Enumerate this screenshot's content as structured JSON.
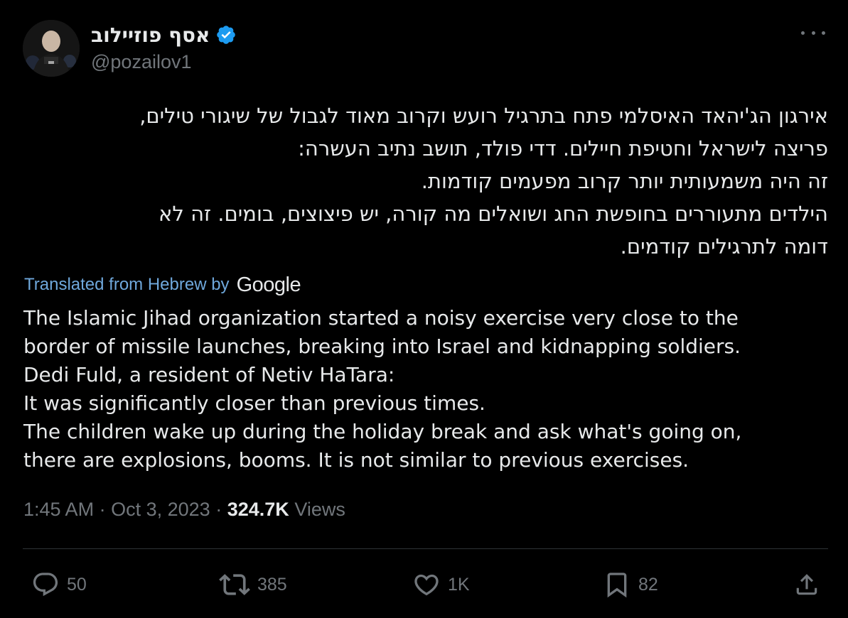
{
  "author": {
    "name": "אסף פוזיילוב",
    "handle": "@pozailov1",
    "verified": true,
    "verified_color": "#1d9bf0"
  },
  "hebrew_text": [
    "אירגון הג'יהאד האיסלמי פתח  בתרגיל רועש וקרוב מאוד לגבול של  שיגורי טילים,",
    "פריצה לישראל  וחטיפת חיילים. דדי פולד, תושב נתיב העשרה:",
    "זה היה משמעותית יותר קרוב מפעמים קודמות.",
    "הילדים מתעוררים בחופשת החג ושואלים מה קורה, יש פיצוצים, בומים. זה לא",
    "דומה לתרגילים קודמים."
  ],
  "translation": {
    "label": "Translated from Hebrew by",
    "provider": "Google",
    "lines": [
      "The Islamic Jihad organization started a noisy exercise very close to the",
      "border of missile launches, breaking into Israel and kidnapping soldiers.",
      "Dedi Fuld, a resident of Netiv HaTara:",
      "It was significantly closer than previous times.",
      "The children wake up during the holiday break and ask what's going on,",
      "there are explosions, booms. It is not similar to previous exercises."
    ]
  },
  "meta": {
    "time": "1:45 AM",
    "separator": "·",
    "date": "Oct 3, 2023",
    "views_count": "324.7K",
    "views_label": "Views"
  },
  "actions": {
    "reply_count": "50",
    "retweet_count": "385",
    "like_count": "1K",
    "bookmark_count": "82"
  },
  "icons": {
    "more": "more-horizontal-icon",
    "reply": "reply-icon",
    "retweet": "retweet-icon",
    "like": "heart-icon",
    "bookmark": "bookmark-icon",
    "share": "share-icon"
  },
  "colors": {
    "background": "#000000",
    "text": "#e7e9ea",
    "secondary": "#71767b",
    "link": "#6fa8dc",
    "divider": "#2f3336"
  }
}
